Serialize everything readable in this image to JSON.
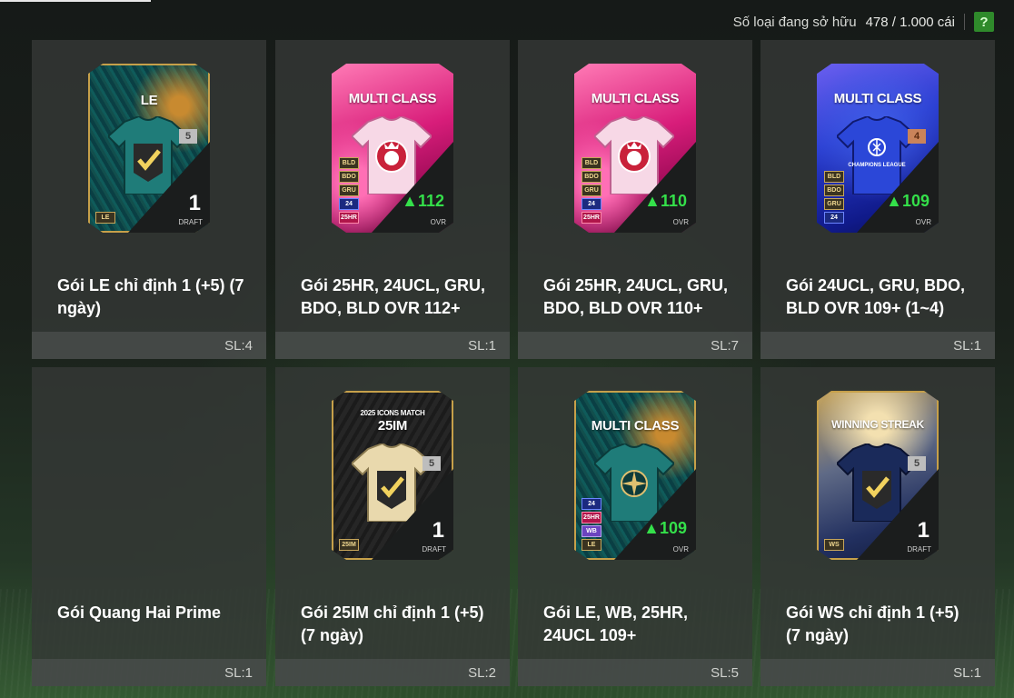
{
  "header": {
    "owned_label": "Số loại đang sở hữu",
    "owned_count": "478 / 1.000 cái",
    "help": "?"
  },
  "colors": {
    "ovr_green": "#34e04a",
    "help_green": "#2f8a2b"
  },
  "packs": [
    {
      "name": "Gói LE chỉ định 1 (+5) (7 ngày)",
      "qty": "SL:4",
      "card": {
        "label": "LE",
        "level": "5",
        "big": "1",
        "sub": "DRAFT",
        "tags": [
          "LE"
        ],
        "icon": "check-shirt-icon"
      }
    },
    {
      "name": "Gói 25HR, 24UCL, GRU, BDO, BLD OVR 112+",
      "qty": "SL:1",
      "card": {
        "label": "MULTI CLASS",
        "ovr": "▲112",
        "sub": "OVR",
        "tags": [
          "BLD",
          "BDO",
          "GRU",
          "24",
          "25HR"
        ],
        "icon": "crest-shirt-icon"
      }
    },
    {
      "name": "Gói 25HR, 24UCL, GRU, BDO, BLD OVR 110+",
      "qty": "SL:7",
      "card": {
        "label": "MULTI CLASS",
        "ovr": "▲110",
        "sub": "OVR",
        "tags": [
          "BLD",
          "BDO",
          "GRU",
          "24",
          "25HR"
        ],
        "icon": "crest-shirt-icon"
      }
    },
    {
      "name": "Gói 24UCL, GRU, BDO, BLD OVR 109+ (1~4)",
      "qty": "SL:1",
      "card": {
        "label": "MULTI CLASS",
        "level": "4",
        "ovr": "▲109",
        "sub": "OVR",
        "tags": [
          "BLD",
          "BDO",
          "GRU",
          "24"
        ],
        "icon": "champions-league-shirt-icon",
        "shirt_text": "CHAMPIONS LEAGUE"
      }
    },
    {
      "name": "Gói Quang Hai Prime",
      "qty": "SL:1",
      "card": null
    },
    {
      "name": "Gói 25IM chỉ định 1 (+5) (7 ngày)",
      "qty": "SL:2",
      "card": {
        "label_top": "2025 ICONS MATCH",
        "label": "25IM",
        "level": "5",
        "big": "1",
        "sub": "DRAFT",
        "tags": [
          "25IM"
        ],
        "icon": "check-shirt-icon"
      }
    },
    {
      "name": "Gói LE, WB, 25HR, 24UCL 109+",
      "qty": "SL:5",
      "card": {
        "label": "MULTI CLASS",
        "ovr": "▲109",
        "sub": "OVR",
        "tags": [
          "24",
          "25HR",
          "WB",
          "LE"
        ],
        "icon": "compass-shirt-icon"
      }
    },
    {
      "name": "Gói WS chỉ định 1 (+5) (7 ngày)",
      "qty": "SL:1",
      "card": {
        "label": "WINNING STREAK",
        "level": "5",
        "big": "1",
        "sub": "DRAFT",
        "tags": [
          "WS"
        ],
        "icon": "check-shirt-icon"
      }
    }
  ]
}
